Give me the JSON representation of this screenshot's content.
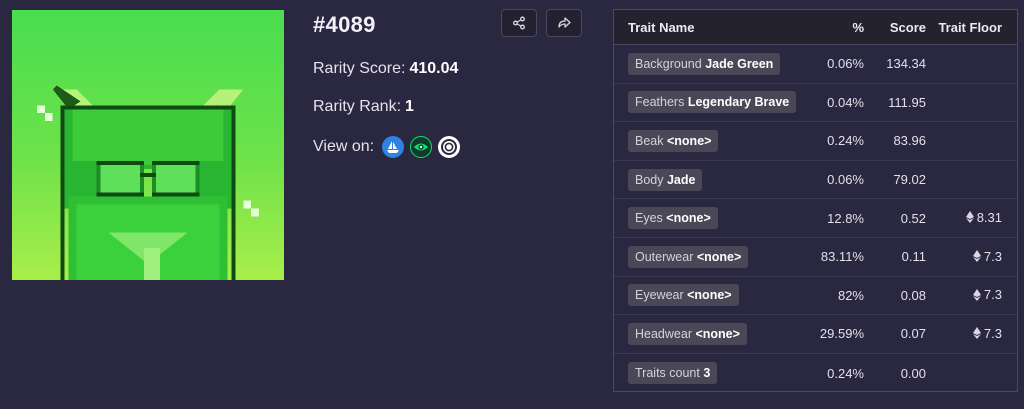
{
  "token": {
    "title": "#4089",
    "rarity_score_label": "Rarity Score:",
    "rarity_score": "410.04",
    "rarity_rank_label": "Rarity Rank:",
    "rarity_rank": "1",
    "view_on_label": "View on:",
    "marketplaces": [
      {
        "name": "opensea",
        "icon": "sailboat-icon",
        "color": "#2f81e4"
      },
      {
        "name": "looksrare",
        "icon": "eye-icon",
        "color": "#0ce466"
      },
      {
        "name": "x2y2",
        "icon": "ring-icon",
        "color": "#ffffff"
      }
    ]
  },
  "actions": {
    "share_icon": "share-icon",
    "forward_icon": "forward-arrow-icon"
  },
  "traits_table": {
    "headers": {
      "name": "Trait Name",
      "pct": "%",
      "score": "Score",
      "floor": "Trait Floor"
    },
    "rows": [
      {
        "type": "Background",
        "value": "Jade Green",
        "pct": "0.06%",
        "score": "134.34",
        "floor": ""
      },
      {
        "type": "Feathers",
        "value": "Legendary Brave",
        "pct": "0.04%",
        "score": "111.95",
        "floor": ""
      },
      {
        "type": "Beak",
        "value": "<none>",
        "pct": "0.24%",
        "score": "83.96",
        "floor": ""
      },
      {
        "type": "Body",
        "value": "Jade",
        "pct": "0.06%",
        "score": "79.02",
        "floor": ""
      },
      {
        "type": "Eyes",
        "value": "<none>",
        "pct": "12.8%",
        "score": "0.52",
        "floor": "8.31"
      },
      {
        "type": "Outerwear",
        "value": "<none>",
        "pct": "83.11%",
        "score": "0.11",
        "floor": "7.3"
      },
      {
        "type": "Eyewear",
        "value": "<none>",
        "pct": "82%",
        "score": "0.08",
        "floor": "7.3"
      },
      {
        "type": "Headwear",
        "value": "<none>",
        "pct": "29.59%",
        "score": "0.07",
        "floor": "7.3"
      },
      {
        "type": "Traits count",
        "value": "3",
        "pct": "0.24%",
        "score": "0.00",
        "floor": ""
      }
    ]
  },
  "colors": {
    "background": "#2a2740",
    "table_header": "#24222f",
    "chip": "#4a4757",
    "image_green": "#49dd4f"
  }
}
